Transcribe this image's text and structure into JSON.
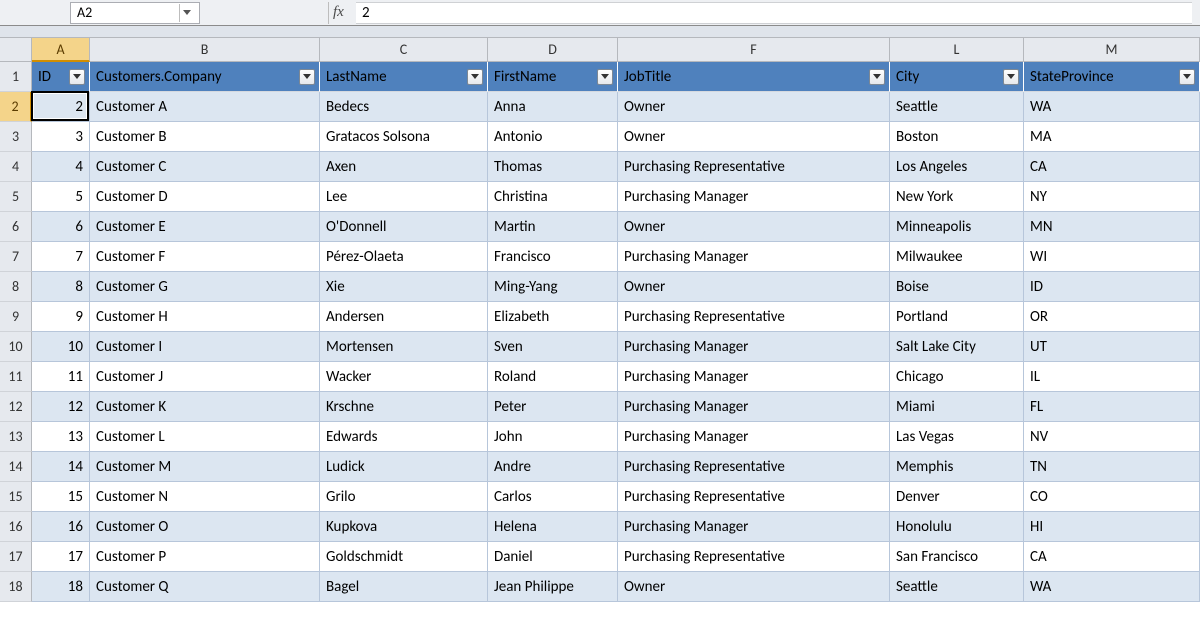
{
  "formula_bar": {
    "cell_ref": "A2",
    "fx_label": "fx",
    "value": "2"
  },
  "columns": [
    "A",
    "B",
    "C",
    "D",
    "F",
    "L",
    "M"
  ],
  "selected_col": "A",
  "headers": [
    "ID",
    "Customers.Company",
    "LastName",
    "FirstName",
    "JobTitle",
    "City",
    "StateProvince"
  ],
  "row_numbers": [
    1,
    2,
    3,
    4,
    5,
    6,
    7,
    8,
    9,
    10,
    11,
    12,
    13,
    14,
    15,
    16,
    17,
    18
  ],
  "selected_row": 2,
  "rows": [
    {
      "id": 2,
      "company": "Customer A",
      "last": "Bedecs",
      "first": "Anna",
      "job": "Owner",
      "city": "Seattle",
      "state": "WA"
    },
    {
      "id": 3,
      "company": "Customer B",
      "last": "Gratacos Solsona",
      "first": "Antonio",
      "job": "Owner",
      "city": "Boston",
      "state": "MA"
    },
    {
      "id": 4,
      "company": "Customer C",
      "last": "Axen",
      "first": "Thomas",
      "job": "Purchasing Representative",
      "city": "Los Angeles",
      "state": "CA"
    },
    {
      "id": 5,
      "company": "Customer D",
      "last": "Lee",
      "first": "Christina",
      "job": "Purchasing Manager",
      "city": "New York",
      "state": "NY"
    },
    {
      "id": 6,
      "company": "Customer E",
      "last": "O'Donnell",
      "first": "Martin",
      "job": "Owner",
      "city": "Minneapolis",
      "state": "MN"
    },
    {
      "id": 7,
      "company": "Customer F",
      "last": "Pérez-Olaeta",
      "first": "Francisco",
      "job": "Purchasing Manager",
      "city": "Milwaukee",
      "state": "WI"
    },
    {
      "id": 8,
      "company": "Customer G",
      "last": "Xie",
      "first": "Ming-Yang",
      "job": "Owner",
      "city": "Boise",
      "state": "ID"
    },
    {
      "id": 9,
      "company": "Customer H",
      "last": "Andersen",
      "first": "Elizabeth",
      "job": "Purchasing Representative",
      "city": "Portland",
      "state": "OR"
    },
    {
      "id": 10,
      "company": "Customer I",
      "last": "Mortensen",
      "first": "Sven",
      "job": "Purchasing Manager",
      "city": "Salt Lake City",
      "state": "UT"
    },
    {
      "id": 11,
      "company": "Customer J",
      "last": "Wacker",
      "first": "Roland",
      "job": "Purchasing Manager",
      "city": "Chicago",
      "state": "IL"
    },
    {
      "id": 12,
      "company": "Customer K",
      "last": "Krschne",
      "first": "Peter",
      "job": "Purchasing Manager",
      "city": "Miami",
      "state": "FL"
    },
    {
      "id": 13,
      "company": "Customer L",
      "last": "Edwards",
      "first": "John",
      "job": "Purchasing Manager",
      "city": "Las Vegas",
      "state": "NV"
    },
    {
      "id": 14,
      "company": "Customer M",
      "last": "Ludick",
      "first": "Andre",
      "job": "Purchasing Representative",
      "city": "Memphis",
      "state": "TN"
    },
    {
      "id": 15,
      "company": "Customer N",
      "last": "Grilo",
      "first": "Carlos",
      "job": "Purchasing Representative",
      "city": "Denver",
      "state": "CO"
    },
    {
      "id": 16,
      "company": "Customer O",
      "last": "Kupkova",
      "first": "Helena",
      "job": "Purchasing Manager",
      "city": "Honolulu",
      "state": "HI"
    },
    {
      "id": 17,
      "company": "Customer P",
      "last": "Goldschmidt",
      "first": "Daniel",
      "job": "Purchasing Representative",
      "city": "San Francisco",
      "state": "CA"
    },
    {
      "id": 18,
      "company": "Customer Q",
      "last": "Bagel",
      "first": "Jean Philippe",
      "job": "Owner",
      "city": "Seattle",
      "state": "WA"
    }
  ]
}
